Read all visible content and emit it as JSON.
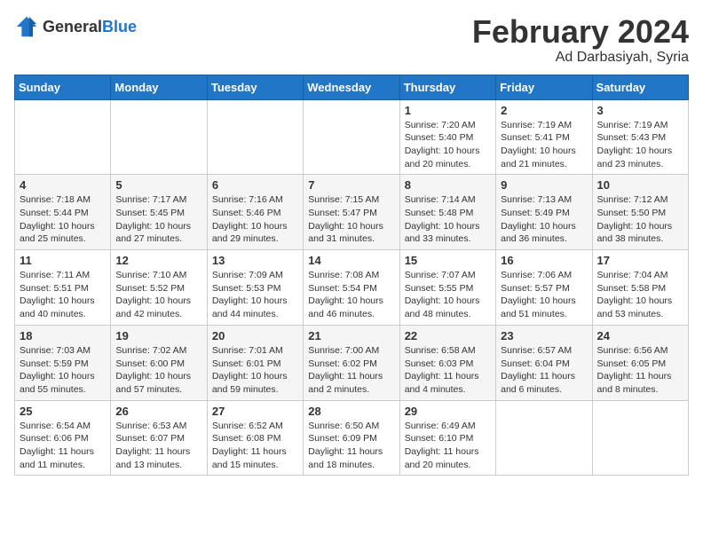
{
  "header": {
    "logo_general": "General",
    "logo_blue": "Blue",
    "month_title": "February 2024",
    "subtitle": "Ad Darbasiyah, Syria"
  },
  "days_of_week": [
    "Sunday",
    "Monday",
    "Tuesday",
    "Wednesday",
    "Thursday",
    "Friday",
    "Saturday"
  ],
  "weeks": [
    [
      {
        "day": "",
        "info": ""
      },
      {
        "day": "",
        "info": ""
      },
      {
        "day": "",
        "info": ""
      },
      {
        "day": "",
        "info": ""
      },
      {
        "day": "1",
        "info": "Sunrise: 7:20 AM\nSunset: 5:40 PM\nDaylight: 10 hours\nand 20 minutes."
      },
      {
        "day": "2",
        "info": "Sunrise: 7:19 AM\nSunset: 5:41 PM\nDaylight: 10 hours\nand 21 minutes."
      },
      {
        "day": "3",
        "info": "Sunrise: 7:19 AM\nSunset: 5:43 PM\nDaylight: 10 hours\nand 23 minutes."
      }
    ],
    [
      {
        "day": "4",
        "info": "Sunrise: 7:18 AM\nSunset: 5:44 PM\nDaylight: 10 hours\nand 25 minutes."
      },
      {
        "day": "5",
        "info": "Sunrise: 7:17 AM\nSunset: 5:45 PM\nDaylight: 10 hours\nand 27 minutes."
      },
      {
        "day": "6",
        "info": "Sunrise: 7:16 AM\nSunset: 5:46 PM\nDaylight: 10 hours\nand 29 minutes."
      },
      {
        "day": "7",
        "info": "Sunrise: 7:15 AM\nSunset: 5:47 PM\nDaylight: 10 hours\nand 31 minutes."
      },
      {
        "day": "8",
        "info": "Sunrise: 7:14 AM\nSunset: 5:48 PM\nDaylight: 10 hours\nand 33 minutes."
      },
      {
        "day": "9",
        "info": "Sunrise: 7:13 AM\nSunset: 5:49 PM\nDaylight: 10 hours\nand 36 minutes."
      },
      {
        "day": "10",
        "info": "Sunrise: 7:12 AM\nSunset: 5:50 PM\nDaylight: 10 hours\nand 38 minutes."
      }
    ],
    [
      {
        "day": "11",
        "info": "Sunrise: 7:11 AM\nSunset: 5:51 PM\nDaylight: 10 hours\nand 40 minutes."
      },
      {
        "day": "12",
        "info": "Sunrise: 7:10 AM\nSunset: 5:52 PM\nDaylight: 10 hours\nand 42 minutes."
      },
      {
        "day": "13",
        "info": "Sunrise: 7:09 AM\nSunset: 5:53 PM\nDaylight: 10 hours\nand 44 minutes."
      },
      {
        "day": "14",
        "info": "Sunrise: 7:08 AM\nSunset: 5:54 PM\nDaylight: 10 hours\nand 46 minutes."
      },
      {
        "day": "15",
        "info": "Sunrise: 7:07 AM\nSunset: 5:55 PM\nDaylight: 10 hours\nand 48 minutes."
      },
      {
        "day": "16",
        "info": "Sunrise: 7:06 AM\nSunset: 5:57 PM\nDaylight: 10 hours\nand 51 minutes."
      },
      {
        "day": "17",
        "info": "Sunrise: 7:04 AM\nSunset: 5:58 PM\nDaylight: 10 hours\nand 53 minutes."
      }
    ],
    [
      {
        "day": "18",
        "info": "Sunrise: 7:03 AM\nSunset: 5:59 PM\nDaylight: 10 hours\nand 55 minutes."
      },
      {
        "day": "19",
        "info": "Sunrise: 7:02 AM\nSunset: 6:00 PM\nDaylight: 10 hours\nand 57 minutes."
      },
      {
        "day": "20",
        "info": "Sunrise: 7:01 AM\nSunset: 6:01 PM\nDaylight: 10 hours\nand 59 minutes."
      },
      {
        "day": "21",
        "info": "Sunrise: 7:00 AM\nSunset: 6:02 PM\nDaylight: 11 hours\nand 2 minutes."
      },
      {
        "day": "22",
        "info": "Sunrise: 6:58 AM\nSunset: 6:03 PM\nDaylight: 11 hours\nand 4 minutes."
      },
      {
        "day": "23",
        "info": "Sunrise: 6:57 AM\nSunset: 6:04 PM\nDaylight: 11 hours\nand 6 minutes."
      },
      {
        "day": "24",
        "info": "Sunrise: 6:56 AM\nSunset: 6:05 PM\nDaylight: 11 hours\nand 8 minutes."
      }
    ],
    [
      {
        "day": "25",
        "info": "Sunrise: 6:54 AM\nSunset: 6:06 PM\nDaylight: 11 hours\nand 11 minutes."
      },
      {
        "day": "26",
        "info": "Sunrise: 6:53 AM\nSunset: 6:07 PM\nDaylight: 11 hours\nand 13 minutes."
      },
      {
        "day": "27",
        "info": "Sunrise: 6:52 AM\nSunset: 6:08 PM\nDaylight: 11 hours\nand 15 minutes."
      },
      {
        "day": "28",
        "info": "Sunrise: 6:50 AM\nSunset: 6:09 PM\nDaylight: 11 hours\nand 18 minutes."
      },
      {
        "day": "29",
        "info": "Sunrise: 6:49 AM\nSunset: 6:10 PM\nDaylight: 11 hours\nand 20 minutes."
      },
      {
        "day": "",
        "info": ""
      },
      {
        "day": "",
        "info": ""
      }
    ]
  ]
}
